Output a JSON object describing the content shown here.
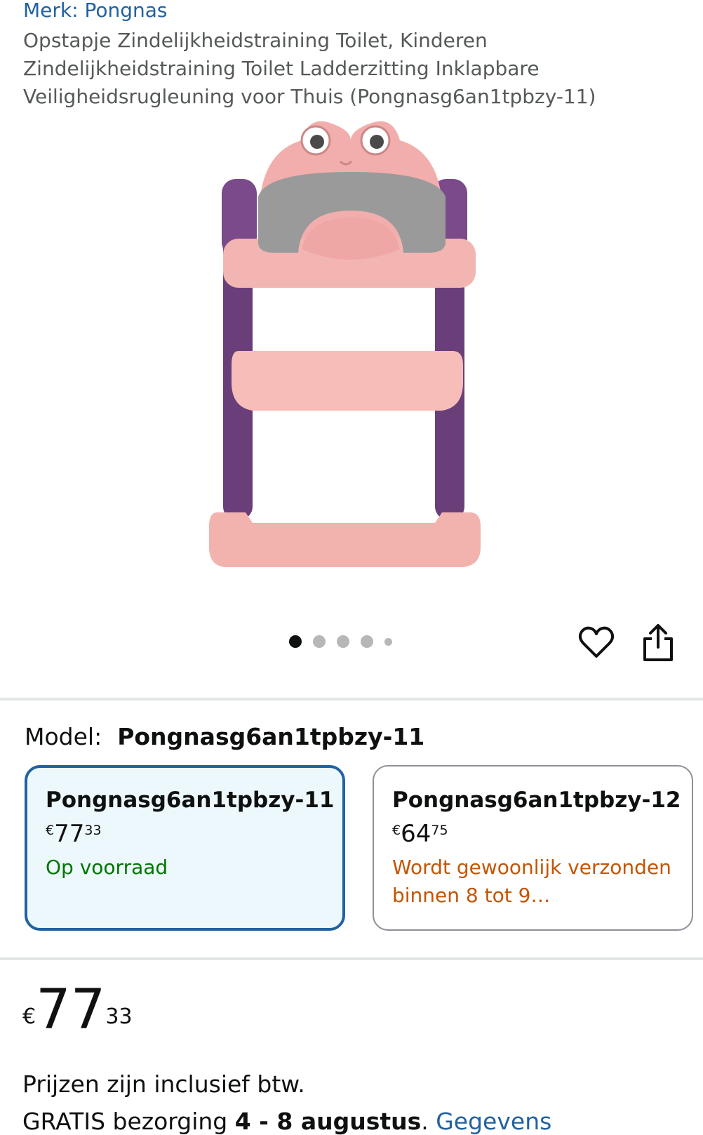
{
  "product": {
    "brand": "Merk: Pongnas",
    "title": "Opstapje Zindelijkheidstraining Toilet, Kinderen Zindelijkheidstraining Toilet Ladderzitting Inklapbare Veiligheidsrugleuning voor Thuis (Pongnasg6an1tpbzy-11)"
  },
  "gallery": {
    "image_icon": "potty-training-ladder-seat-image",
    "total_dots": 5,
    "active_index": 0
  },
  "actions": {
    "wishlist_icon": "heart-icon",
    "share_icon": "share-icon"
  },
  "model": {
    "label": "Model:",
    "value": "Pongnasg6an1tpbzy-11"
  },
  "variants": [
    {
      "name": "Pongnasg6an1tpbzy-11",
      "currency": "€",
      "whole": "77",
      "fraction": "33",
      "status": "Op voorraad"
    },
    {
      "name": "Pongnasg6an1tpbzy-12",
      "currency": "€",
      "whole": "64",
      "fraction": "75",
      "status": "Wordt gewoonlijk verzonden binnen 8 tot 9…"
    }
  ],
  "price": {
    "currency": "€",
    "whole": "77",
    "fraction": "33",
    "tax_note": "Prijzen zijn inclusief btw."
  },
  "delivery": {
    "prefix": "GRATIS bezorging",
    "dates": "4 - 8 augustus",
    "details_link": "Gegevens"
  },
  "colors": {
    "link": "#2162a1",
    "in_stock": "#007600",
    "shipping_note": "#c45500",
    "selected_border": "#2162a1",
    "selected_bg": "#edf8fd"
  }
}
